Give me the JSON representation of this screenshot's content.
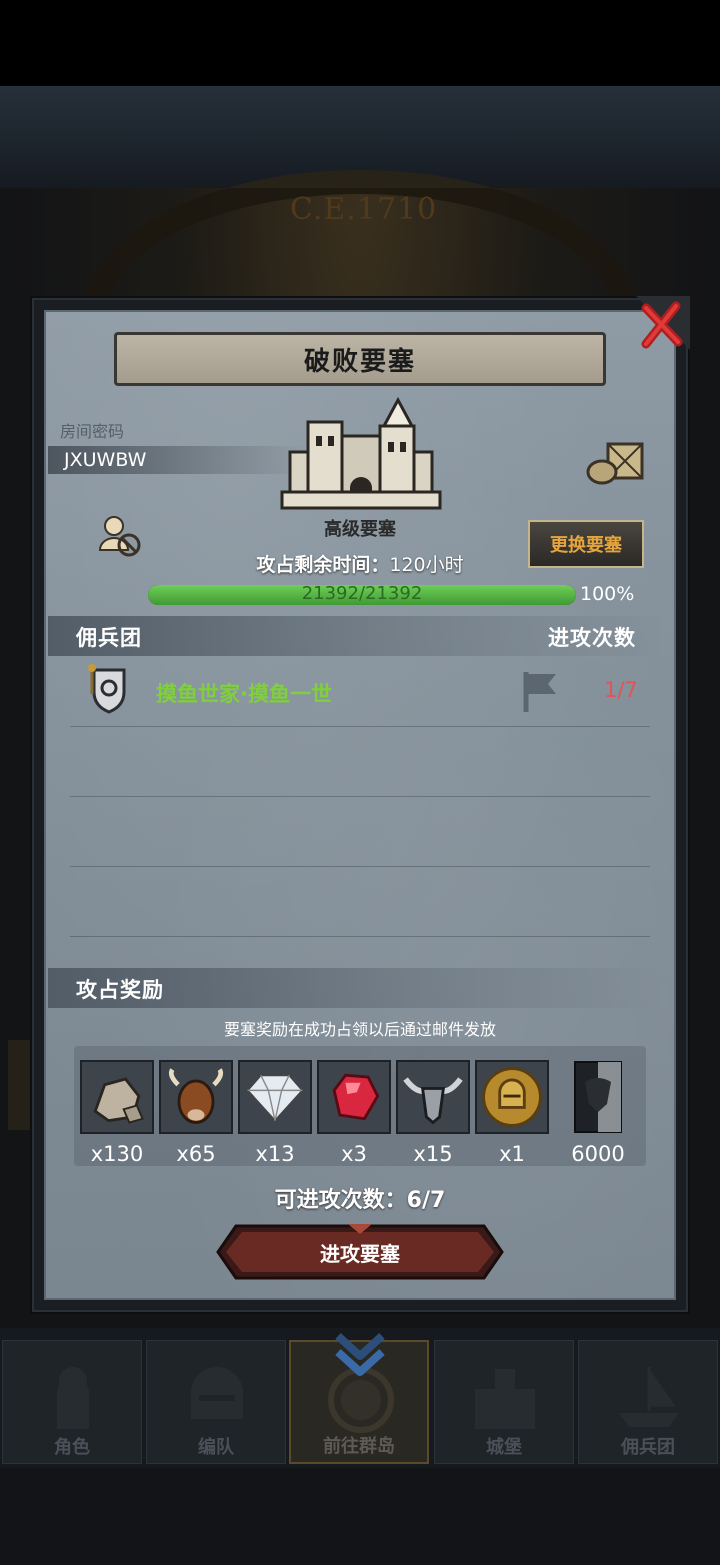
{
  "background": {
    "year_text": "C.E.1710"
  },
  "dialog": {
    "title": "破败要塞",
    "room_label": "房间密码",
    "room_code": "JXUWBW",
    "fortress_type": "高级要塞",
    "remaining_label": "攻占剩余时间：",
    "remaining_value": "120小时",
    "change_button": "更换要塞",
    "hp": {
      "text": "21392/21392",
      "current": 21392,
      "max": 21392,
      "percent_text": "100%",
      "bar_color": "#5fbf4a"
    },
    "mercenary_section": {
      "title": "佣兵团",
      "count_header": "进攻次数",
      "rows": [
        {
          "name": "摸鱼世家·摸鱼一世",
          "count": "1/7",
          "name_color": "#7fd03a",
          "count_color": "#e25454"
        }
      ]
    },
    "rewards_section": {
      "title": "攻占奖励",
      "note": "要塞奖励在成功占领以后通过邮件发放",
      "items": [
        {
          "icon": "stone-icon",
          "qty": "x130"
        },
        {
          "icon": "bull-icon",
          "qty": "x65"
        },
        {
          "icon": "diamond-icon",
          "qty": "x13"
        },
        {
          "icon": "ruby-icon",
          "qty": "x3"
        },
        {
          "icon": "horned-helm-icon",
          "qty": "x15"
        },
        {
          "icon": "knight-medal-icon",
          "qty": "x1"
        },
        {
          "icon": "bull-banner-icon",
          "qty": "6000"
        }
      ]
    },
    "attempts_label": "可进攻次数：6/7",
    "attack_button": "进攻要塞"
  },
  "nav": {
    "tabs": [
      {
        "label": "角色",
        "active": false
      },
      {
        "label": "编队",
        "active": false
      },
      {
        "label": "前往群岛",
        "active": true
      },
      {
        "label": "城堡",
        "active": false
      },
      {
        "label": "佣兵团",
        "active": false
      }
    ]
  }
}
